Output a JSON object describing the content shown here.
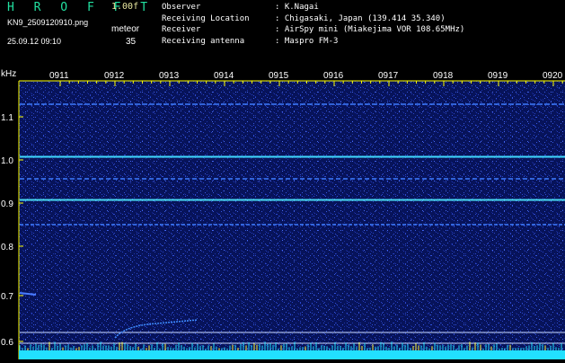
{
  "header": {
    "app_title": "H R O F F T",
    "version": "1.00f",
    "filename": "KN9_2509120910.png",
    "meteor_label": "meteor",
    "datetime": "25.09.12 09:10",
    "meteor_count": "35",
    "info": [
      {
        "label": "Observer",
        "value": ": K.Nagai"
      },
      {
        "label": "Receiving Location",
        "value": ": Chigasaki, Japan (139.414 35.340)"
      },
      {
        "label": "Receiver",
        "value": ": AirSpy mini (Miakejima VOR 108.65MHz)"
      },
      {
        "label": "Receiving antenna",
        "value": ": Maspro FM-3"
      }
    ]
  },
  "spectrogram": {
    "y_unit": "kHz",
    "y_ticks": [
      "1.1",
      "1.0",
      "0.9",
      "0.8",
      "0.7",
      "0.6"
    ],
    "time_ticks": [
      "0911",
      "0912",
      "0913",
      "0914",
      "0915",
      "0916",
      "0917",
      "0918",
      "0919",
      "0920"
    ],
    "background_color": "#0a1a6e",
    "line_color": "#40d8ff",
    "axis_color": "#ffff00",
    "level_bar_color": "#22e0ff"
  }
}
